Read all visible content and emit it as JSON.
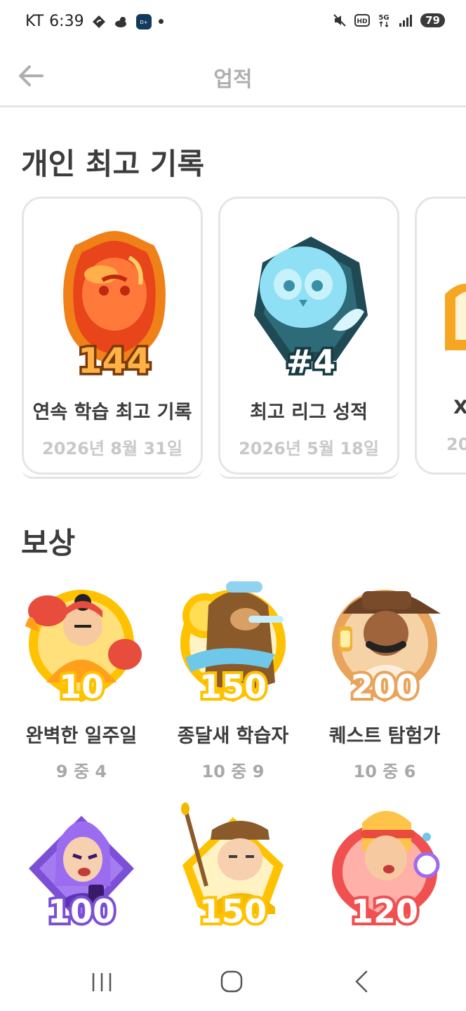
{
  "status_bar": {
    "carrier": "KT",
    "time": "6:39",
    "icons": [
      "navigation-icon",
      "weather-icon",
      "app-icon",
      "dot-icon",
      "mute-icon",
      "hd-icon",
      "5g-icon",
      "signal-icon"
    ],
    "battery": "79"
  },
  "header": {
    "title": "업적",
    "back_icon": "arrow-left-icon"
  },
  "personal_records": {
    "title": "개인 최고 기록",
    "cards": [
      {
        "label": "연속 학습 최고 기록",
        "date": "2026년 8월 31일",
        "badge_value": "144",
        "color": "#f57c1f"
      },
      {
        "label": "최고 리그 성적",
        "date": "2026년 5월 18일",
        "badge_value": "#4",
        "color": "#5fc8e8"
      },
      {
        "label": "X",
        "date": "20",
        "color": "#f5a623"
      }
    ]
  },
  "rewards": {
    "title": "보상",
    "items": [
      {
        "label": "완벽한 일주일",
        "progress": "9 중 4",
        "badge_value": "10",
        "color": "#ffc200"
      },
      {
        "label": "종달새 학습자",
        "progress": "10 중 9",
        "badge_value": "150",
        "color": "#ffc200"
      },
      {
        "label": "퀘스트 탐험가",
        "progress": "10 중 6",
        "badge_value": "200",
        "color": "#f0a040"
      },
      {
        "label": "",
        "progress": "",
        "badge_value": "100",
        "color": "#7b4fd6"
      },
      {
        "label": "",
        "progress": "",
        "badge_value": "150",
        "color": "#ffc200"
      },
      {
        "label": "",
        "progress": "",
        "badge_value": "120",
        "color": "#f05050"
      }
    ]
  },
  "nav_bar": {
    "buttons": [
      "recent-apps-icon",
      "home-icon",
      "back-icon"
    ]
  }
}
